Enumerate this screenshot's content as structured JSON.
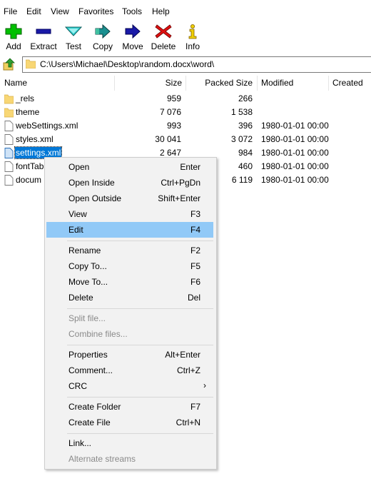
{
  "menubar": [
    "File",
    "Edit",
    "View",
    "Favorites",
    "Tools",
    "Help"
  ],
  "toolbar": [
    {
      "label": "Add",
      "icon": "plus-icon",
      "color": "#00b000"
    },
    {
      "label": "Extract",
      "icon": "minus-icon",
      "color": "#1a1aa8"
    },
    {
      "label": "Test",
      "icon": "check-chevron-icon",
      "color": "#20c0c0"
    },
    {
      "label": "Copy",
      "icon": "copy-arrow-icon",
      "color": "#1a8a8a"
    },
    {
      "label": "Move",
      "icon": "move-arrow-icon",
      "color": "#1a1aa8"
    },
    {
      "label": "Delete",
      "icon": "delete-x-icon",
      "color": "#e01010"
    },
    {
      "label": "Info",
      "icon": "info-icon",
      "color": "#e0c000"
    }
  ],
  "address": {
    "path": "C:\\Users\\Michael\\Desktop\\random.docx\\word\\"
  },
  "columns": {
    "name": "Name",
    "size": "Size",
    "packed": "Packed Size",
    "modified": "Modified",
    "created": "Created"
  },
  "files": [
    {
      "name": "_rels",
      "type": "folder",
      "size": "959",
      "packed": "266",
      "modified": ""
    },
    {
      "name": "theme",
      "type": "folder",
      "size": "7 076",
      "packed": "1 538",
      "modified": ""
    },
    {
      "name": "webSettings.xml",
      "type": "file",
      "size": "993",
      "packed": "396",
      "modified": "1980-01-01 00:00"
    },
    {
      "name": "styles.xml",
      "type": "file",
      "size": "30 041",
      "packed": "3 072",
      "modified": "1980-01-01 00:00"
    },
    {
      "name": "settings.xml",
      "type": "file",
      "size": "2 647",
      "packed": "984",
      "modified": "1980-01-01 00:00",
      "selected": true
    },
    {
      "name": "fontTab",
      "type": "file",
      "size": "",
      "packed": "460",
      "modified": "1980-01-01 00:00"
    },
    {
      "name": "docum",
      "type": "file",
      "size": "",
      "packed": "6 119",
      "modified": "1980-01-01 00:00"
    }
  ],
  "context_menu": [
    {
      "label": "Open",
      "shortcut": "Enter"
    },
    {
      "label": "Open Inside",
      "shortcut": "Ctrl+PgDn"
    },
    {
      "label": "Open Outside",
      "shortcut": "Shift+Enter"
    },
    {
      "label": "View",
      "shortcut": "F3"
    },
    {
      "label": "Edit",
      "shortcut": "F4",
      "highlighted": true
    },
    {
      "separator": true
    },
    {
      "label": "Rename",
      "shortcut": "F2"
    },
    {
      "label": "Copy To...",
      "shortcut": "F5"
    },
    {
      "label": "Move To...",
      "shortcut": "F6"
    },
    {
      "label": "Delete",
      "shortcut": "Del"
    },
    {
      "separator": true
    },
    {
      "label": "Split file...",
      "shortcut": "",
      "disabled": true
    },
    {
      "label": "Combine files...",
      "shortcut": "",
      "disabled": true
    },
    {
      "separator": true
    },
    {
      "label": "Properties",
      "shortcut": "Alt+Enter"
    },
    {
      "label": "Comment...",
      "shortcut": "Ctrl+Z"
    },
    {
      "label": "CRC",
      "shortcut": "",
      "submenu": true
    },
    {
      "separator": true
    },
    {
      "label": "Create Folder",
      "shortcut": "F7"
    },
    {
      "label": "Create File",
      "shortcut": "Ctrl+N"
    },
    {
      "separator": true
    },
    {
      "label": "Link...",
      "shortcut": ""
    },
    {
      "label": "Alternate streams",
      "shortcut": "",
      "disabled": true
    }
  ]
}
